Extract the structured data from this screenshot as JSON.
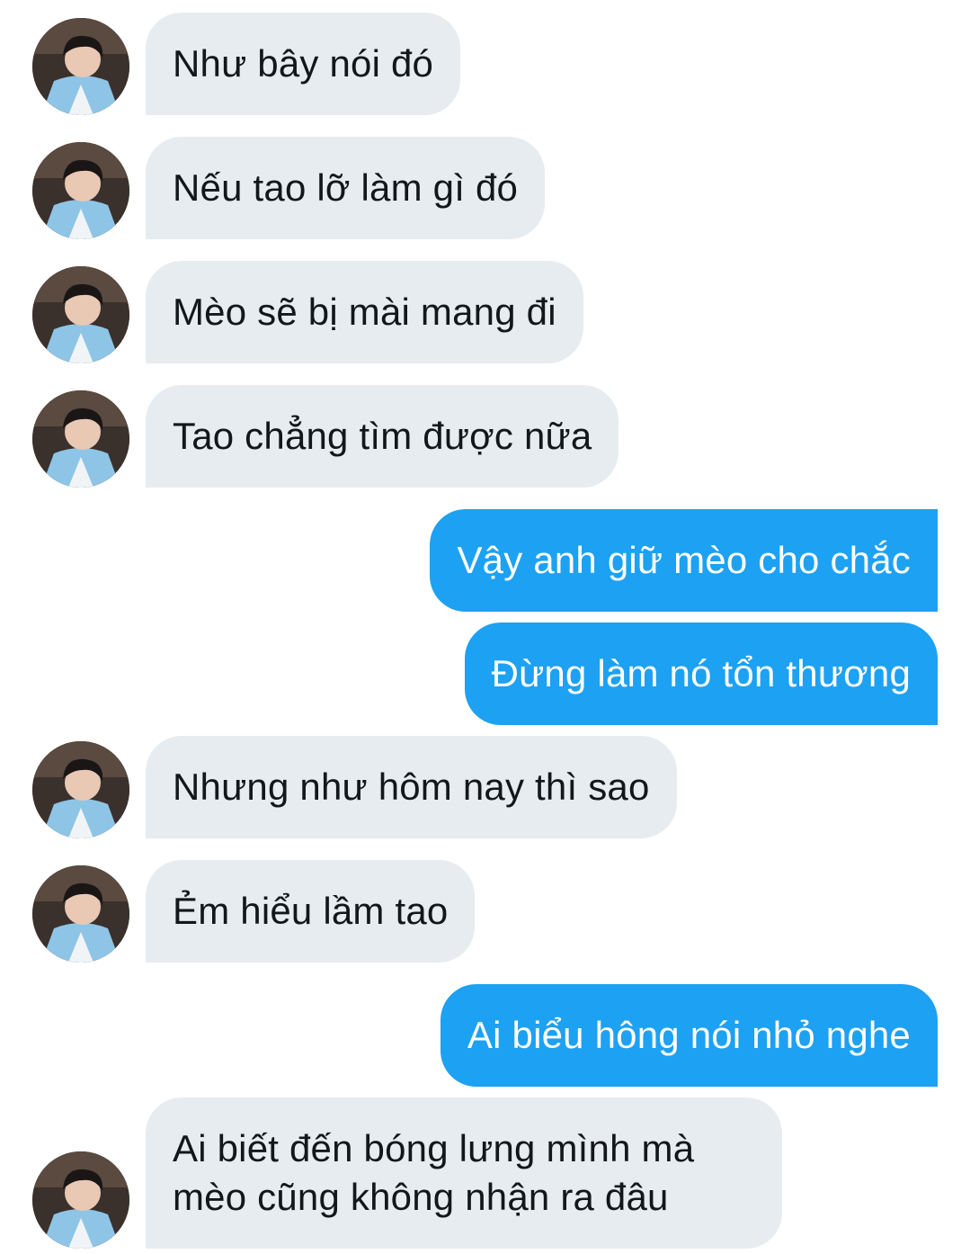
{
  "conversation": {
    "messages": [
      {
        "sender": "them",
        "text": "Như bây nói đó"
      },
      {
        "sender": "them",
        "text": "Nếu tao lỡ làm gì đó"
      },
      {
        "sender": "them",
        "text": "Mèo sẽ bị mài mang đi"
      },
      {
        "sender": "them",
        "text": "Tao chẳng tìm được nữa"
      },
      {
        "sender": "me",
        "text": "Vậy anh giữ mèo cho chắc"
      },
      {
        "sender": "me",
        "text": "Đừng làm nó tổn thương"
      },
      {
        "sender": "them",
        "text": "Nhưng như hôm nay thì sao"
      },
      {
        "sender": "them",
        "text": "Ẻm hiểu lầm tao"
      },
      {
        "sender": "me",
        "text": "Ai biểu hông nói nhỏ nghe"
      },
      {
        "sender": "them",
        "lines": [
          "Ai biết đến bóng lưng mình mà",
          "mèo cũng không nhận ra đâu"
        ]
      }
    ]
  },
  "colors": {
    "incoming_bubble": "#e6ecf0",
    "incoming_text": "#14171a",
    "outgoing_bubble": "#1da1f2",
    "outgoing_text": "#ffffff"
  },
  "icons": {
    "avatar": "profile-photo-avatar"
  }
}
